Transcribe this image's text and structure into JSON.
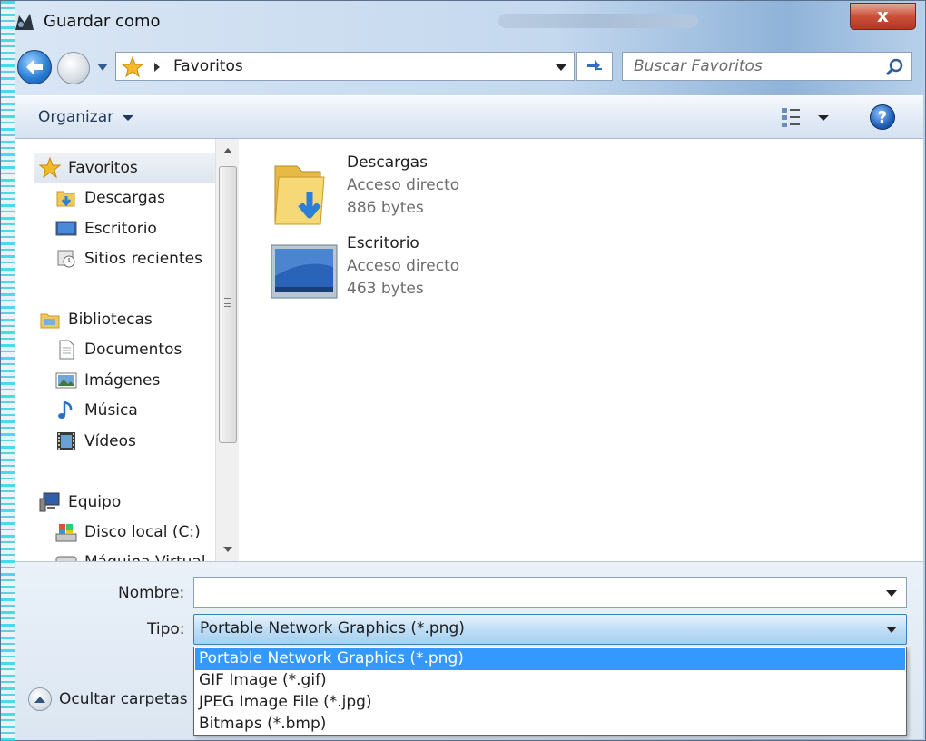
{
  "window": {
    "title": "Guardar como",
    "close_label": "x"
  },
  "navigation": {
    "address": "Favoritos",
    "search_placeholder": "Buscar Favoritos"
  },
  "toolbar": {
    "organize_label": "Organizar",
    "help_label": "?"
  },
  "sidebar": {
    "groups": [
      {
        "label": "Favoritos",
        "icon": "star-icon",
        "items": [
          {
            "label": "Descargas",
            "icon": "downloads-folder-icon"
          },
          {
            "label": "Escritorio",
            "icon": "desktop-icon"
          },
          {
            "label": "Sitios recientes",
            "icon": "recent-places-icon"
          }
        ]
      },
      {
        "label": "Bibliotecas",
        "icon": "libraries-icon",
        "items": [
          {
            "label": "Documentos",
            "icon": "documents-icon"
          },
          {
            "label": "Imágenes",
            "icon": "pictures-icon"
          },
          {
            "label": "Música",
            "icon": "music-icon"
          },
          {
            "label": "Vídeos",
            "icon": "videos-icon"
          }
        ]
      },
      {
        "label": "Equipo",
        "icon": "computer-icon",
        "items": [
          {
            "label": "Disco local (C:)",
            "icon": "local-disk-icon"
          },
          {
            "label": "Máquina Virtual",
            "icon": "drive-icon"
          }
        ]
      }
    ]
  },
  "files": [
    {
      "name": "Descargas",
      "type": "Acceso directo",
      "size": "886 bytes",
      "icon": "downloads-folder-icon"
    },
    {
      "name": "Escritorio",
      "type": "Acceso directo",
      "size": "463 bytes",
      "icon": "desktop-icon"
    }
  ],
  "save": {
    "name_label": "Nombre:",
    "name_value": "",
    "type_label": "Tipo:",
    "type_value": "Portable Network Graphics (*.png)",
    "type_options": [
      "Portable Network Graphics (*.png)",
      "GIF Image (*.gif)",
      "JPEG Image File (*.jpg)",
      "Bitmaps (*.bmp)"
    ],
    "hide_folders_label": "Ocultar carpetas"
  },
  "colors": {
    "selection": "#3399ff",
    "accent": "#1e395b",
    "close": "#c9503a"
  }
}
